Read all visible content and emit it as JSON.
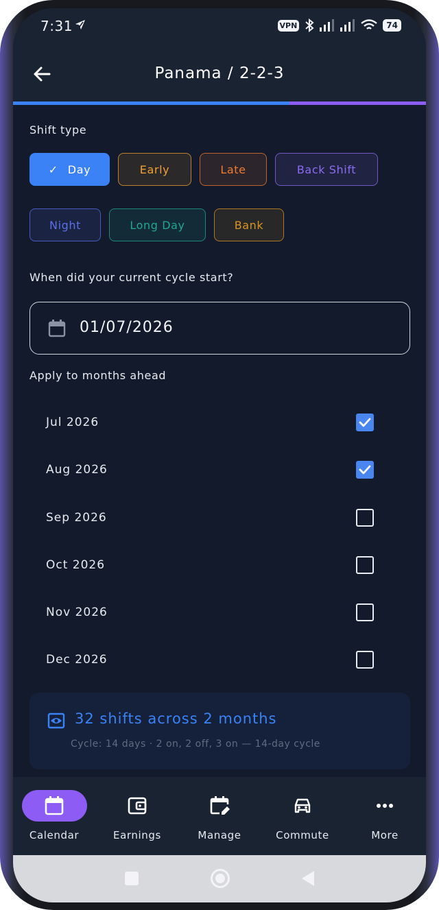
{
  "status_bar": {
    "time": "7:31",
    "vpn_label": "VPN",
    "battery_level": "74"
  },
  "app_bar": {
    "title": "Panama / 2-2-3",
    "back_icon": "arrow-left-icon",
    "progress_fraction": 0.67,
    "progress_colors": [
      "#3b82f6",
      "#8d5cf5"
    ]
  },
  "shift_type": {
    "label": "Shift type",
    "options": [
      {
        "label": "Day",
        "selected": true,
        "color": "#3b82f6"
      },
      {
        "label": "Early",
        "selected": false,
        "color": "#f0a030"
      },
      {
        "label": "Late",
        "selected": false,
        "color": "#f07a30"
      },
      {
        "label": "Back Shift",
        "selected": false,
        "color": "#8d6cf0"
      },
      {
        "label": "Night",
        "selected": false,
        "color": "#5a6fe8"
      },
      {
        "label": "Long Day",
        "selected": false,
        "color": "#20a890"
      },
      {
        "label": "Bank",
        "selected": false,
        "color": "#d89420"
      }
    ]
  },
  "cycle_start": {
    "label": "When did your current cycle start?",
    "value": "01/07/2026",
    "icon": "calendar-icon"
  },
  "months_ahead": {
    "label": "Apply to months ahead",
    "months": [
      {
        "label": "Jul 2026",
        "checked": true
      },
      {
        "label": "Aug 2026",
        "checked": true
      },
      {
        "label": "Sep 2026",
        "checked": false
      },
      {
        "label": "Oct 2026",
        "checked": false
      },
      {
        "label": "Nov 2026",
        "checked": false
      },
      {
        "label": "Dec 2026",
        "checked": false
      }
    ]
  },
  "summary": {
    "title": "32 shifts across 2 months",
    "subtitle": "Cycle: 14 days · 2 on, 2 off, 3 on — 14-day cycle",
    "icon": "eye-icon"
  },
  "bottom_nav": {
    "items": [
      {
        "label": "Calendar",
        "icon": "calendar-icon",
        "active": true
      },
      {
        "label": "Earnings",
        "icon": "wallet-icon",
        "active": false
      },
      {
        "label": "Manage",
        "icon": "edit-calendar-icon",
        "active": false
      },
      {
        "label": "Commute",
        "icon": "car-icon",
        "active": false
      },
      {
        "label": "More",
        "icon": "more-dots-icon",
        "active": false
      }
    ]
  },
  "accent_color": "#3b82f6",
  "nav_active_color": "#8d5cf5",
  "background_color": "#121a2b"
}
